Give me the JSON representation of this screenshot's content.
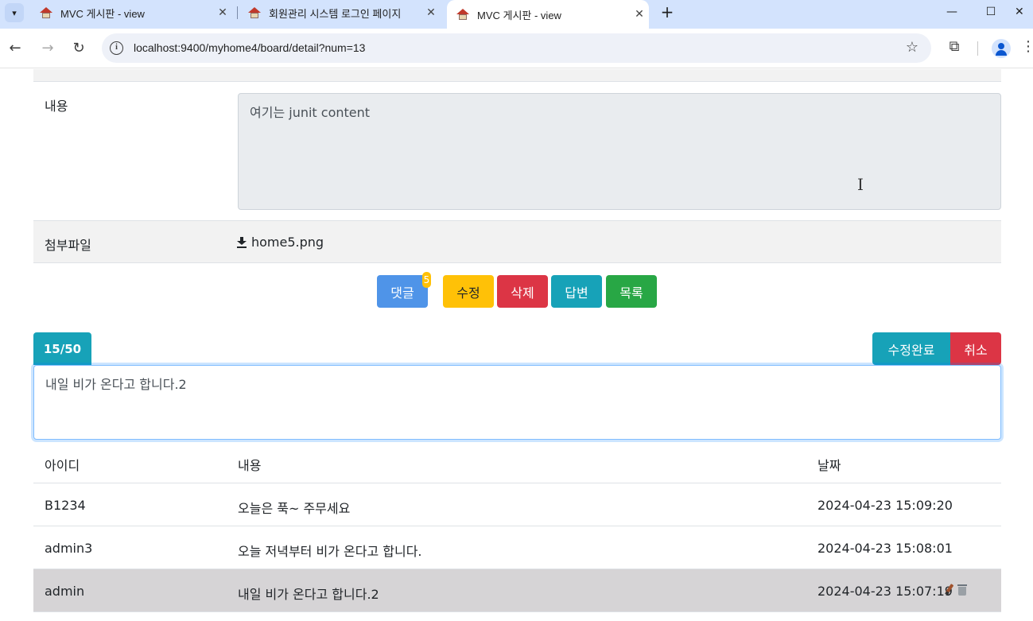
{
  "browser": {
    "tabs": [
      {
        "title": "MVC 게시판 - view",
        "active": false
      },
      {
        "title": "회원관리 시스템 로그인 페이지",
        "active": false
      },
      {
        "title": "MVC 게시판 - view",
        "active": true
      }
    ],
    "url": "localhost:9400/myhome4/board/detail?num=13",
    "new_tab_label": "+",
    "close_label": "✕",
    "controls": {
      "minimize": "—",
      "maximize": "☐",
      "close": "✕"
    }
  },
  "detail": {
    "content_label": "내용",
    "content_value": "여기는 junit content",
    "attach_label": "첨부파일",
    "attach_file": "home5.png"
  },
  "actions": {
    "comment_label": "댓글",
    "comment_count": "5",
    "edit_label": "수정",
    "delete_label": "삭제",
    "reply_label": "답변",
    "list_label": "목록"
  },
  "comment_editor": {
    "counter": "15/50",
    "value": "내일 비가 온다고 합니다.2",
    "save_label": "수정완료",
    "cancel_label": "취소"
  },
  "comments": {
    "headers": [
      "아이디",
      "내용",
      "날짜"
    ],
    "rows": [
      {
        "id": "B1234",
        "content": "오늘은 푹~ 주무세요",
        "date": "2024-04-23 15:09:20"
      },
      {
        "id": "admin3",
        "content": "오늘 저녁부터 비가 온다고 합니다.",
        "date": "2024-04-23 15:08:01"
      },
      {
        "id": "admin",
        "content": "내일 비가 온다고 합니다.2",
        "date": "2024-04-23 15:07:19"
      }
    ]
  },
  "colors": {
    "info": "#17a2b8",
    "warning": "#ffc107",
    "danger": "#dc3545",
    "success": "#28a745",
    "primary": "#4f94e8"
  }
}
